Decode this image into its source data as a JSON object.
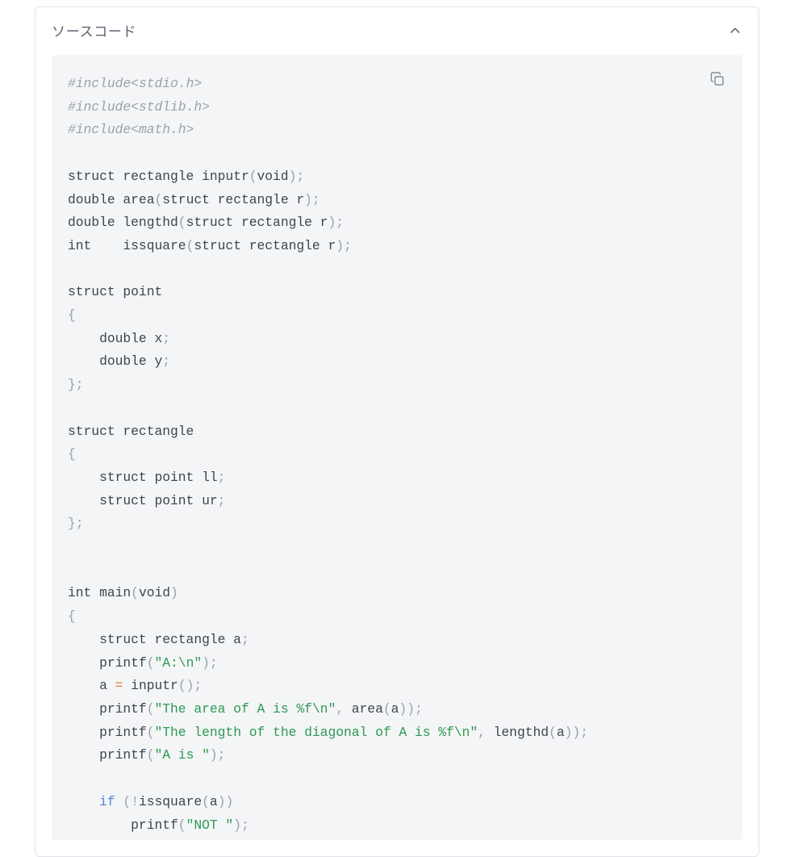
{
  "panel": {
    "title": "ソースコード"
  },
  "icons": {
    "chevron_up": "chevron-up",
    "copy": "copy"
  },
  "code": {
    "l01_a": "#include",
    "l01_b": "<stdio.h>",
    "l02_a": "#include",
    "l02_b": "<stdlib.h>",
    "l03_a": "#include",
    "l03_b": "<math.h>",
    "l05_a": "struct rectangle inputr",
    "l05_b": "(",
    "l05_c": "void",
    "l05_d": ");",
    "l06_a": "double area",
    "l06_b": "(",
    "l06_c": "struct rectangle r",
    "l06_d": ");",
    "l07_a": "double lengthd",
    "l07_b": "(",
    "l07_c": "struct rectangle r",
    "l07_d": ");",
    "l08_a": "int    issquare",
    "l08_b": "(",
    "l08_c": "struct rectangle r",
    "l08_d": ");",
    "l10": "struct point",
    "l11": "{",
    "l12_a": "    double x",
    "l12_b": ";",
    "l13_a": "    double y",
    "l13_b": ";",
    "l14": "};",
    "l16": "struct rectangle",
    "l17": "{",
    "l18_a": "    struct point ll",
    "l18_b": ";",
    "l19_a": "    struct point ur",
    "l19_b": ";",
    "l20": "};",
    "l23_a": "int main",
    "l23_b": "(",
    "l23_c": "void",
    "l23_d": ")",
    "l24": "{",
    "l25_a": "    struct rectangle a",
    "l25_b": ";",
    "l26_a": "    printf",
    "l26_b": "(",
    "l26_c": "\"A:\\n\"",
    "l26_d": ");",
    "l27_a": "    a ",
    "l27_b": "=",
    "l27_c": " inputr",
    "l27_d": "();",
    "l28_a": "    printf",
    "l28_b": "(",
    "l28_c": "\"The area of A is %f\\n\"",
    "l28_d": ",",
    "l28_e": " area",
    "l28_f": "(",
    "l28_g": "a",
    "l28_h": "));",
    "l29_a": "    printf",
    "l29_b": "(",
    "l29_c": "\"The length of the diagonal of A is %f\\n\"",
    "l29_d": ",",
    "l29_e": " lengthd",
    "l29_f": "(",
    "l29_g": "a",
    "l29_h": "));",
    "l30_a": "    printf",
    "l30_b": "(",
    "l30_c": "\"A is \"",
    "l30_d": ");",
    "l32_a": "    ",
    "l32_b": "if",
    "l32_c": " ",
    "l32_d": "(!",
    "l32_e": "issquare",
    "l32_f": "(",
    "l32_g": "a",
    "l32_h": "))",
    "l33_a": "        printf",
    "l33_b": "(",
    "l33_c": "\"NOT \"",
    "l33_d": ");"
  }
}
